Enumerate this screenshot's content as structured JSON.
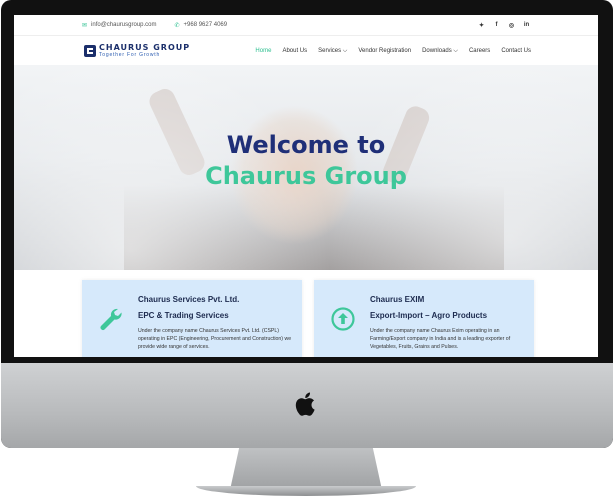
{
  "topbar": {
    "email": "info@chaurusgroup.com",
    "phone": "+968 9627 4069",
    "email_icon": "mail-icon",
    "phone_icon": "phone-icon",
    "social": [
      "twitter-icon",
      "facebook-icon",
      "instagram-icon",
      "linkedin-icon"
    ]
  },
  "brand": {
    "name": "CHAURUS GROUP",
    "tagline": "Together For Growth"
  },
  "nav": {
    "items": [
      {
        "label": "Home",
        "active": true
      },
      {
        "label": "About Us"
      },
      {
        "label": "Services ⌵"
      },
      {
        "label": "Vendor Registration"
      },
      {
        "label": "Downloads ⌵"
      },
      {
        "label": "Careers"
      },
      {
        "label": "Contact Us"
      }
    ]
  },
  "hero": {
    "line1": "Welcome to",
    "line2": "Chaurus Group"
  },
  "cards": [
    {
      "icon": "wrench-icon",
      "title": "Chaurus Services Pvt. Ltd.",
      "subtitle": "EPC & Trading Services",
      "description": "Under the company name Chaurus Services Pvt. Ltd. (CSPL) operating in EPC (Engineering, Procurement and Construction) we provide wide range of services."
    },
    {
      "icon": "arrow-up-circle-icon",
      "title": "Chaurus EXIM",
      "subtitle": "Export-Import – Agro Products",
      "description": "Under the company name Chaurus Exim operating in an Farming/Export company in India and is a leading exporter of Vegetables, Fruits, Grains and Pulses."
    }
  ],
  "colors": {
    "accent": "#2bbf8f",
    "brand_blue": "#1f2f78",
    "card_bg": "#d6e9fb"
  },
  "device": {
    "logo_icon": "apple-logo-icon"
  }
}
